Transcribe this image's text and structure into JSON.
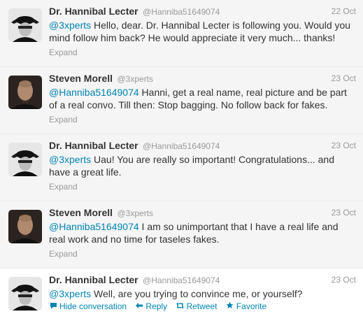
{
  "tweets": [
    {
      "name": "Dr. Hannibal Lecter",
      "handle": "@Hanniba51649074",
      "time": "22 Oct",
      "mention": "@3xperts",
      "body": " Hello, dear. Dr. Hannibal Lecter is following you. Would you mind follow him back? He would appreciate it very much... thanks!",
      "expand": "Expand",
      "avatar": "hannibal-avatar"
    },
    {
      "name": "Steven Morell",
      "handle": "@3xperts",
      "time": "23 Oct",
      "mention": "@Hanniba51649074",
      "body": " Hanni, get a real name, real picture and be part of a real convo. Till then: Stop bagging. No follow back for fakes.",
      "expand": "Expand",
      "avatar": "steven-avatar"
    },
    {
      "name": "Dr. Hannibal Lecter",
      "handle": "@Hanniba51649074",
      "time": "23 Oct",
      "mention": "@3xperts",
      "body": " Uau! You are really so important! Congratulations... and have a great life.",
      "expand": "Expand",
      "avatar": "hannibal-avatar"
    },
    {
      "name": "Steven Morell",
      "handle": "@3xperts",
      "time": "23 Oct",
      "mention": "@Hanniba51649074",
      "body": " I am so unimportant that I have a real life and real work and no time for taseles fakes.",
      "expand": "Expand",
      "avatar": "steven-avatar"
    },
    {
      "name": "Dr. Hannibal Lecter",
      "handle": "@Hanniba51649074",
      "time": "23 Oct",
      "mention": "@3xperts",
      "body": " Well, are you trying to convince me, or yourself?",
      "avatar": "hannibal-avatar",
      "actions": {
        "hide": "Hide conversation",
        "reply": "Reply",
        "retweet": "Retweet",
        "favorite": "Favorite"
      }
    }
  ],
  "colors": {
    "link": "#0084b4",
    "muted": "#999999",
    "highlight_bg": "#f5f5f5"
  }
}
